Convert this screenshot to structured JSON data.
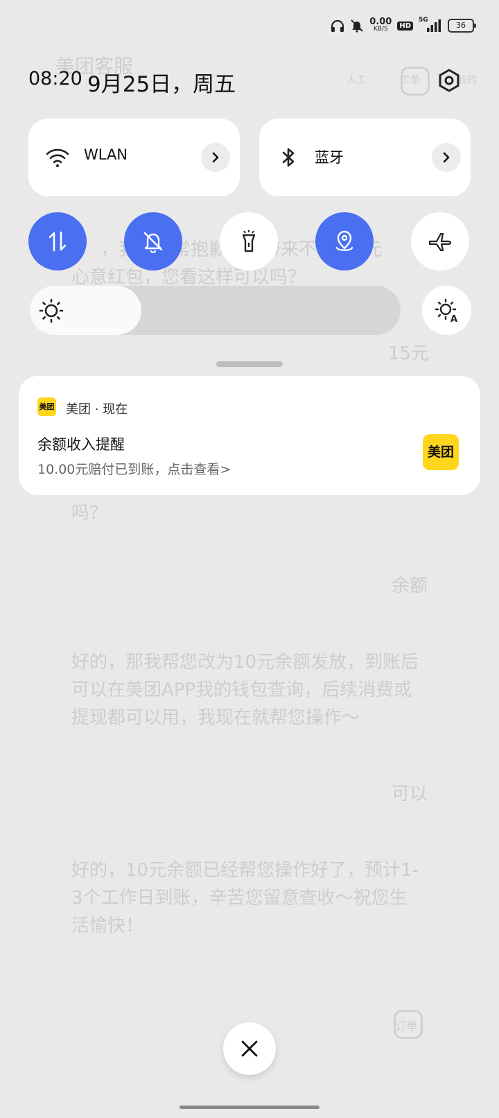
{
  "status_bar": {
    "net_speed": "0.00",
    "net_unit": "KB/S",
    "hd": "HD",
    "signal": "5G",
    "battery": "36",
    "icons": [
      "headphones-icon",
      "mute-icon",
      "signal-icon",
      "battery-icon"
    ]
  },
  "header": {
    "time": "08:20",
    "date": "9月25日，周五",
    "settings_icon": "gear-icon"
  },
  "tiles": {
    "wlan": {
      "label": "WLAN",
      "icon": "wifi-icon"
    },
    "bluetooth": {
      "label": "蓝牙",
      "icon": "bluetooth-icon"
    }
  },
  "toggles": [
    {
      "name": "mobile-data",
      "icon": "data-arrows-icon",
      "active": true
    },
    {
      "name": "silent",
      "icon": "bell-off-icon",
      "active": true
    },
    {
      "name": "flashlight",
      "icon": "flashlight-icon",
      "active": false
    },
    {
      "name": "location",
      "icon": "location-icon",
      "active": true
    },
    {
      "name": "airplane",
      "icon": "airplane-icon",
      "active": false
    }
  ],
  "brightness": {
    "level": 0.3,
    "auto_icon": "auto-brightness-icon"
  },
  "notification": {
    "app_icon_text": "美团",
    "app_name": "美团 · 现在",
    "title": "余额收入提醒",
    "body": "10.00元赔付已到账，点击查看>",
    "thumbnail_text": "美团"
  },
  "background_app": {
    "title": "美团客服",
    "header_buttons": [
      "人工",
      "工单",
      "我的"
    ],
    "messages": [
      "，我们非常抱歉给您带来不便，0元",
      "心意红包，您看这样可以吗？",
      "15元",
      "吗？",
      "余额",
      "好的，那我帮您改为10元余额发放，到账后",
      "可以在美团APP我的钱包查询，后续消费或",
      "提现都可以用，我现在就帮您操作～",
      "可以",
      "好的，10元余额已经帮您操作好了，预计1-",
      "3个工作日到账，辛苦您留意查收～祝您生",
      "活愉快！",
      "订单"
    ]
  },
  "colors": {
    "accent": "#4a6ff0",
    "shade_bg": "#e9e9ea",
    "meituan_yellow": "#ffd61e"
  },
  "close_icon": "close-icon"
}
